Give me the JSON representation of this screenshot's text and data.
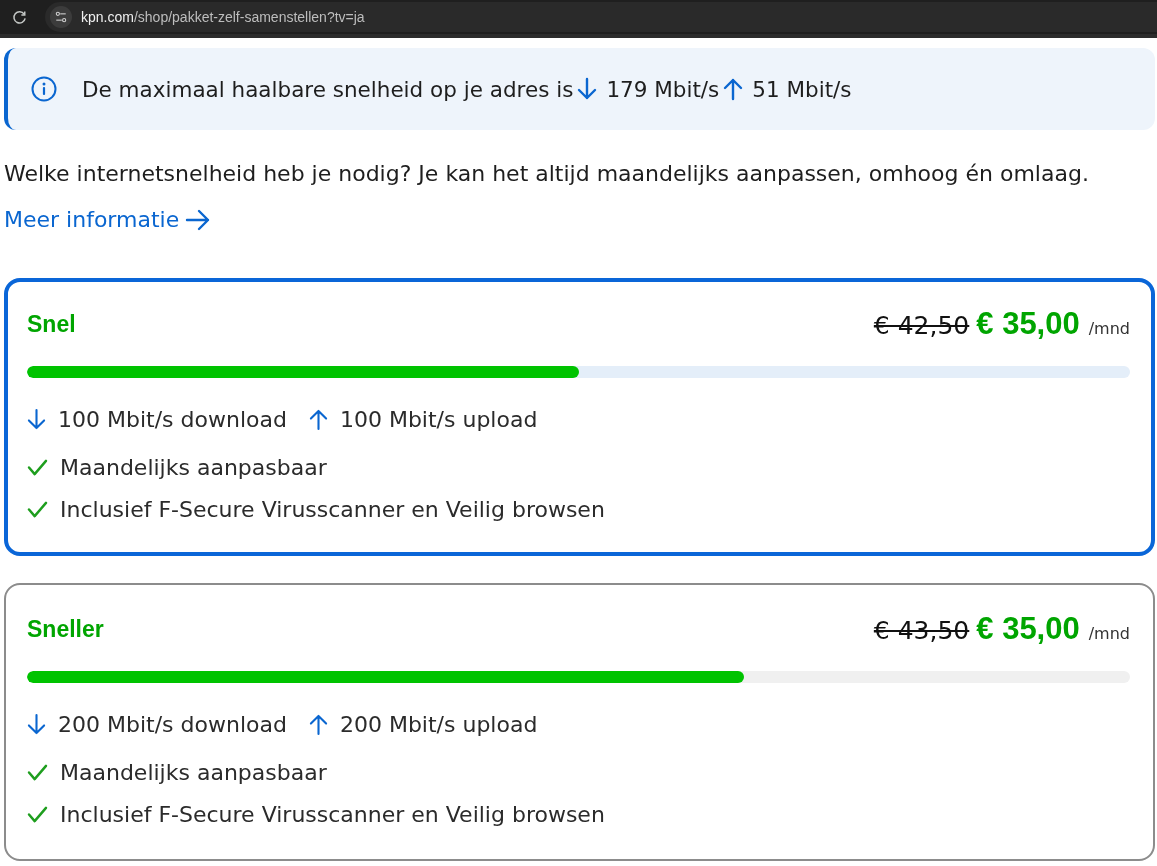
{
  "browser": {
    "url_host": "kpn.com",
    "url_path": "/shop/pakket-zelf-samenstellen?tv=ja"
  },
  "info_banner": {
    "text": "De maximaal haalbare snelheid op je adres is",
    "download": "179 Mbit/s",
    "upload": "51 Mbit/s"
  },
  "intro": "Welke internetsnelheid heb je nodig? Je kan het altijd maandelijks aanpassen, omhoog én omlaag.",
  "more_link": "Meer informatie",
  "packages": [
    {
      "name": "Snel",
      "selected": true,
      "old_price": "€ 42,50",
      "price": "€ 35,00",
      "period": "/mnd",
      "level": 0.5,
      "download": "100 Mbit/s download",
      "upload": "100 Mbit/s upload",
      "features": [
        "Maandelijks aanpasbaar",
        "Inclusief F-Secure Virusscanner en Veilig browsen"
      ]
    },
    {
      "name": "Sneller",
      "selected": false,
      "old_price": "€ 43,50",
      "price": "€ 35,00",
      "period": "/mnd",
      "level": 0.65,
      "download": "200 Mbit/s download",
      "upload": "200 Mbit/s upload",
      "features": [
        "Maandelijks aanpasbaar",
        "Inclusief F-Secure Virusscanner en Veilig browsen"
      ]
    }
  ]
}
